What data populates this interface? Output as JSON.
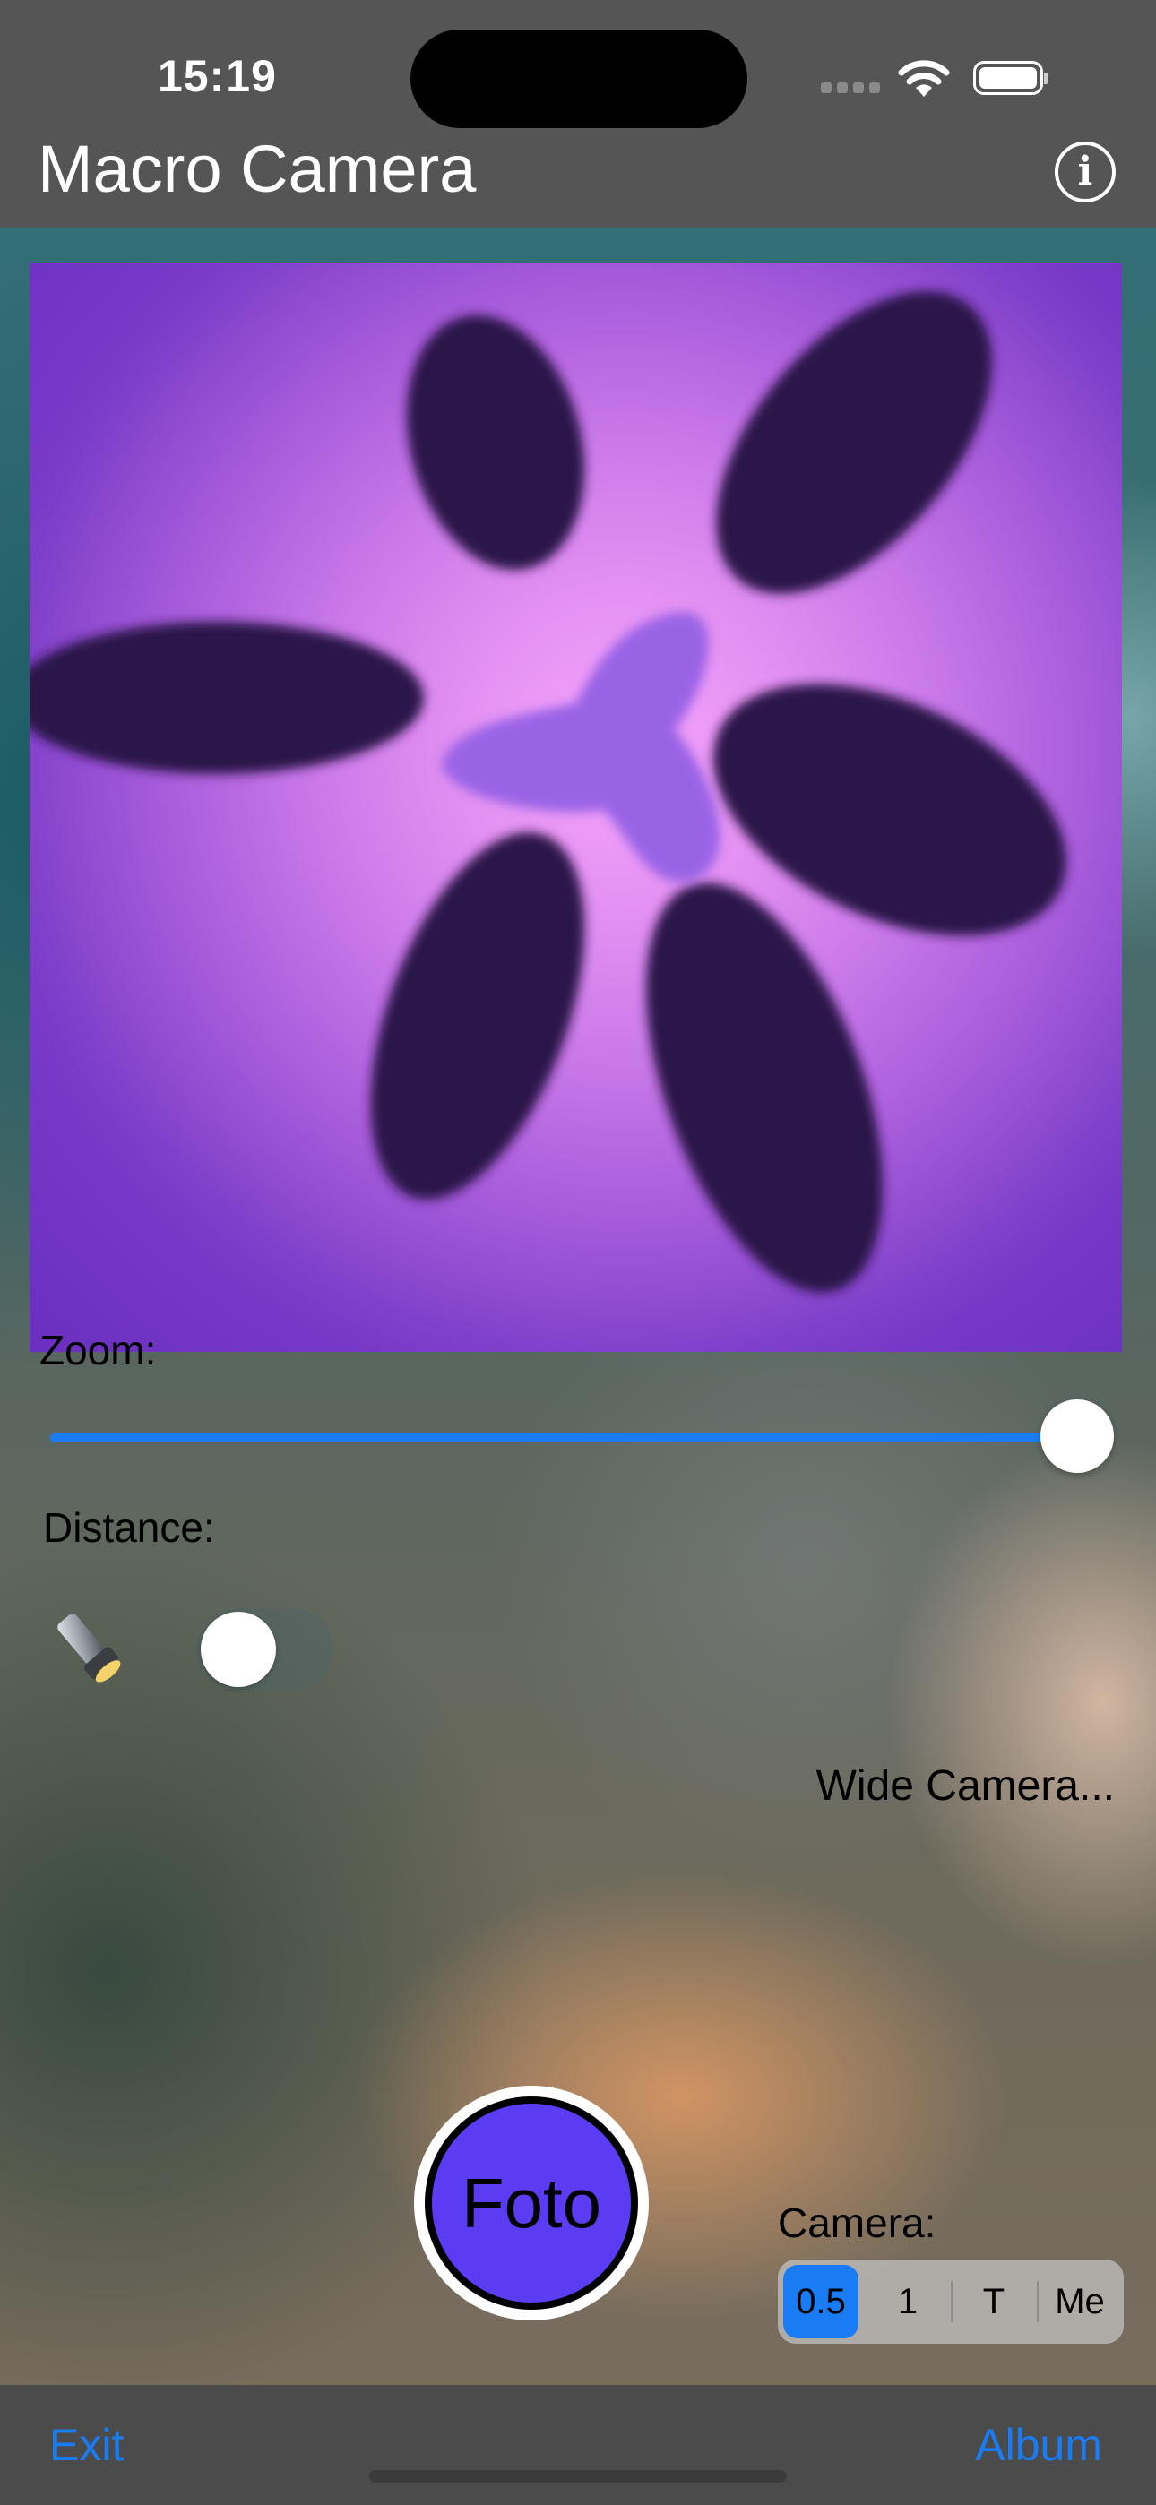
{
  "status_bar": {
    "time": "15:19"
  },
  "nav": {
    "title": "Macro Camera",
    "info_icon": "info-circle-icon",
    "info_glyph": "i"
  },
  "controls": {
    "zoom_label": "Zoom:",
    "zoom_value": 1.0,
    "distance_label": "Distance:",
    "torch_icon": "flashlight-icon",
    "torch_on": false,
    "camera_status": "Wide Camera...",
    "shutter_label": "Foto",
    "camera_label": "Camera:",
    "camera_options": [
      "0.5",
      "1",
      "T",
      "Me"
    ],
    "camera_selected": "0.5"
  },
  "bottom_bar": {
    "exit_label": "Exit",
    "album_label": "Album"
  },
  "colors": {
    "accent": "#1a7cf5",
    "shutter": "#5c3cf2",
    "bar": "#555555"
  }
}
